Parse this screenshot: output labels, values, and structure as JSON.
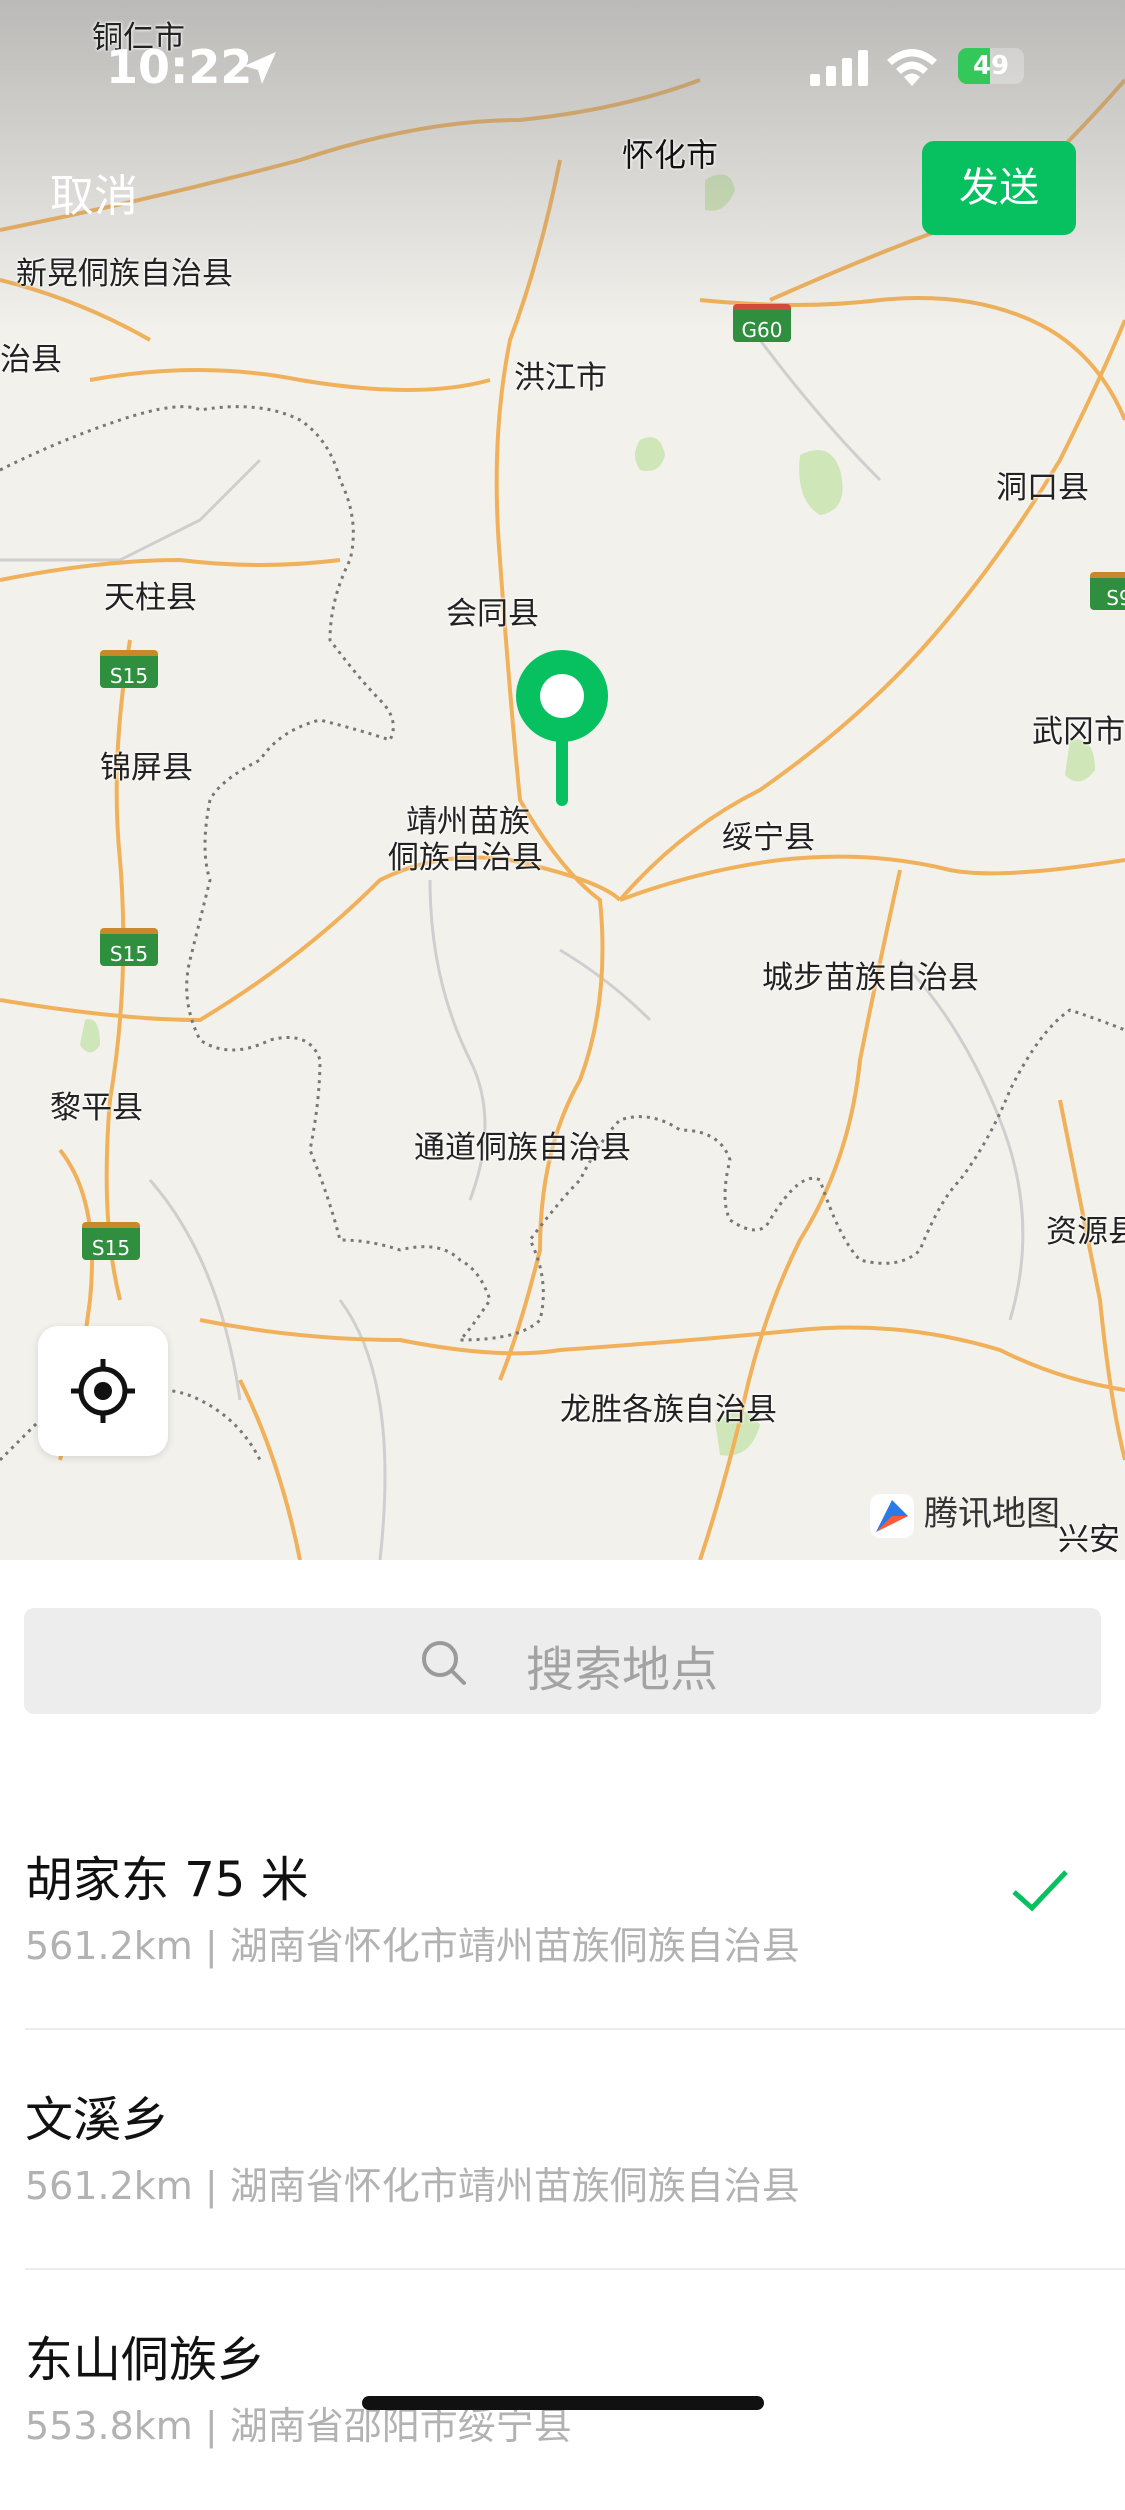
{
  "status_bar": {
    "time": "10:22",
    "battery": "49"
  },
  "header": {
    "cancel_label": "取消",
    "send_label": "发送"
  },
  "map": {
    "labels": [
      {
        "id": "tongren",
        "text": "铜仁市"
      },
      {
        "id": "huaihua",
        "text": "怀化市"
      },
      {
        "id": "xinhuang",
        "text": "新晃侗族自治县"
      },
      {
        "id": "zhixian",
        "text": "治县"
      },
      {
        "id": "hongjiang",
        "text": "洪江市"
      },
      {
        "id": "dongkou",
        "text": "洞口县"
      },
      {
        "id": "tianzhu",
        "text": "天柱县"
      },
      {
        "id": "huitong",
        "text": "会同县"
      },
      {
        "id": "wugang",
        "text": "武冈市"
      },
      {
        "id": "jinping",
        "text": "锦屏县"
      },
      {
        "id": "jingzhou1",
        "text": "靖州苗族"
      },
      {
        "id": "jingzhou2",
        "text": "侗族自治县"
      },
      {
        "id": "suining",
        "text": "绥宁县"
      },
      {
        "id": "chengbu",
        "text": "城步苗族自治县"
      },
      {
        "id": "liping",
        "text": "黎平县"
      },
      {
        "id": "tongdao",
        "text": "通道侗族自治县"
      },
      {
        "id": "ziyuan",
        "text": "资源县"
      },
      {
        "id": "longsheng",
        "text": "龙胜各族自治县"
      },
      {
        "id": "xingan",
        "text": "兴安"
      }
    ],
    "shields": [
      {
        "id": "g60",
        "text": "G60"
      },
      {
        "id": "s15a",
        "text": "S15"
      },
      {
        "id": "s15b",
        "text": "S15"
      },
      {
        "id": "s15c",
        "text": "S15"
      },
      {
        "id": "s9",
        "text": "S9"
      }
    ],
    "watermark": "腾讯地图",
    "accent_color": "#07c160"
  },
  "search": {
    "placeholder": "搜索地点"
  },
  "results": [
    {
      "name": "胡家东 75 米",
      "address": "561.2km | 湖南省怀化市靖州苗族侗族自治县",
      "selected": true
    },
    {
      "name": "文溪乡",
      "address": "561.2km | 湖南省怀化市靖州苗族侗族自治县",
      "selected": false
    },
    {
      "name": "东山侗族乡",
      "address": "553.8km | 湖南省邵阳市绥宁县",
      "selected": false
    }
  ]
}
